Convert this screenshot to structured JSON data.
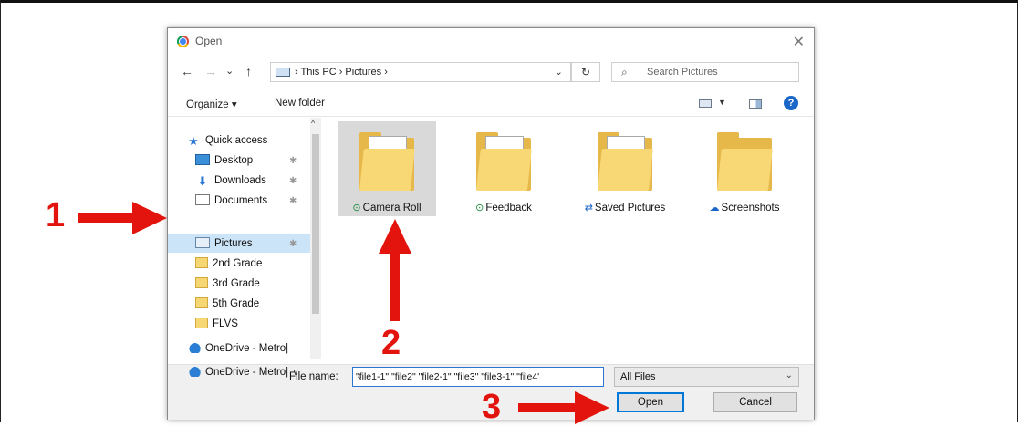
{
  "dialog": {
    "title": "Open",
    "close_symbol": "✕",
    "nav": {
      "back": "←",
      "forward": "→",
      "recent": "⌄",
      "up": "↑"
    },
    "address": {
      "crumbs": "› This PC › Pictures ›",
      "dropdown": "⌄",
      "refresh": "↻"
    },
    "search": {
      "placeholder": "Search Pictures",
      "icon": "⌕"
    },
    "toolbar": {
      "organize": "Organize ▾",
      "new_folder": "New folder",
      "view_caret": "▼",
      "help": "?"
    },
    "sidebar": {
      "scroll_up": "^",
      "items": [
        {
          "label": "Quick access",
          "icon": "star-icon"
        },
        {
          "label": "Desktop",
          "icon": "desktop-icon",
          "pinned": true
        },
        {
          "label": "Downloads",
          "icon": "download-icon",
          "pinned": true
        },
        {
          "label": "Documents",
          "icon": "documents-icon",
          "pinned": true
        },
        {
          "label": "Pictures",
          "icon": "pictures-icon",
          "pinned": true,
          "selected": true
        },
        {
          "label": "2nd Grade",
          "icon": "folder-icon"
        },
        {
          "label": "3rd Grade",
          "icon": "folder-icon"
        },
        {
          "label": "5th Grade",
          "icon": "folder-icon"
        },
        {
          "label": "FLVS",
          "icon": "folder-icon"
        },
        {
          "label": "OneDrive - Metro|",
          "icon": "onedrive-error-icon"
        },
        {
          "label": "OneDrive - Metro|",
          "icon": "onedrive-shared-icon"
        }
      ],
      "pin_symbol": "✱",
      "star_symbol": "★",
      "down_symbol": "⬇",
      "more_symbol": "∨"
    },
    "folders": [
      {
        "name": "Camera Roll",
        "status": "⊙",
        "selected": true
      },
      {
        "name": "Feedback",
        "status": "⊙"
      },
      {
        "name": "Saved Pictures",
        "status": "⇄"
      },
      {
        "name": "Screenshots",
        "status": "☁"
      }
    ],
    "file_name_label": "File name:",
    "file_name_value": "\"file1-1\" \"file2\" \"file2-1\" \"file3\" \"file3-1\" \"file4'",
    "file_name_drop": "⌄",
    "file_type": "All Files",
    "file_type_drop": "⌄",
    "open_button": "Open",
    "cancel_button": "Cancel"
  },
  "annotations": {
    "one": "1",
    "two": "2",
    "three": "3"
  },
  "colors": {
    "accent": "#0078d7",
    "arrow": "#e3140d",
    "selection": "#cce4f7"
  }
}
